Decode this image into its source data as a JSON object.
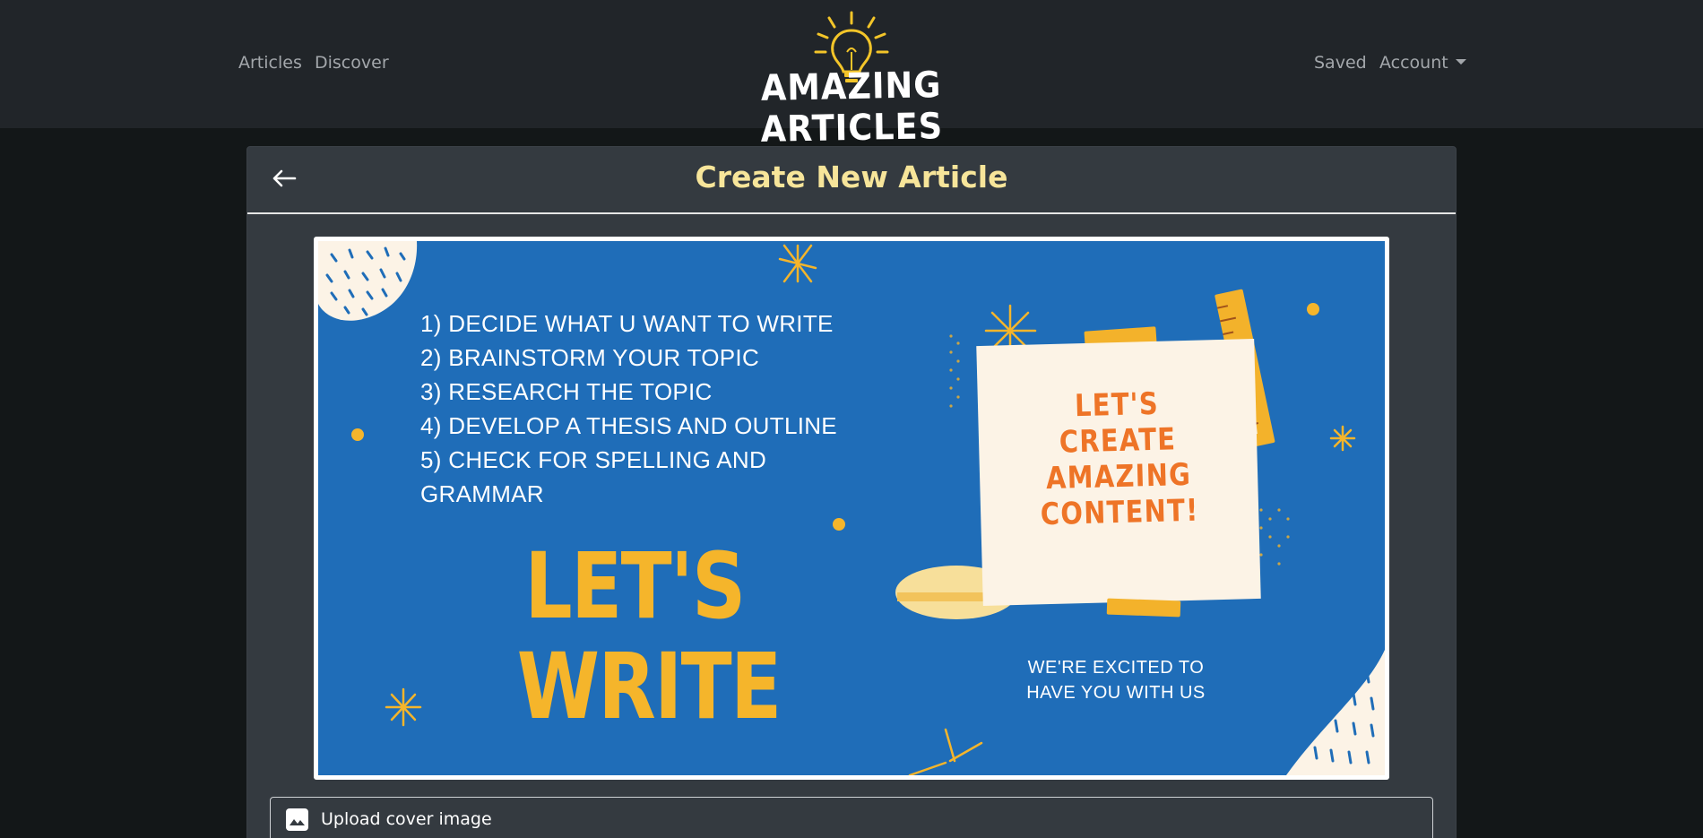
{
  "navbar": {
    "left_links": [
      "Articles",
      "Discover"
    ],
    "brand": "AMAZING ARTICLES",
    "right_links": {
      "saved": "Saved",
      "account": "Account"
    }
  },
  "page": {
    "title": "Create New Article",
    "back_icon": "arrow-left-icon"
  },
  "cover_image": {
    "steps": [
      "1) DECIDE WHAT U WANT TO WRITE",
      "2) BRAINSTORM YOUR TOPIC",
      "3) RESEARCH THE TOPIC",
      "4) DEVELOP A THESIS AND OUTLINE",
      "5) CHECK FOR SPELLING AND",
      "GRAMMAR"
    ],
    "headline": [
      "LET'S",
      "WRITE"
    ],
    "note_text": [
      "LET'S",
      "CREATE",
      "AMAZING",
      "CONTENT!"
    ],
    "footer_text": [
      "WE'RE EXCITED TO",
      "HAVE YOU WITH US"
    ],
    "colors": {
      "background": "#1f6db8",
      "accent": "#f5b52b",
      "note": "#fcf3e6",
      "note_text": "#ee7427"
    }
  },
  "upload": {
    "label": "Upload cover image",
    "icon": "image-icon"
  },
  "theme": {
    "navbar_bg": "#212529",
    "page_bg": "#131718",
    "card_bg": "#343a40",
    "title_color": "#f7e59a"
  }
}
